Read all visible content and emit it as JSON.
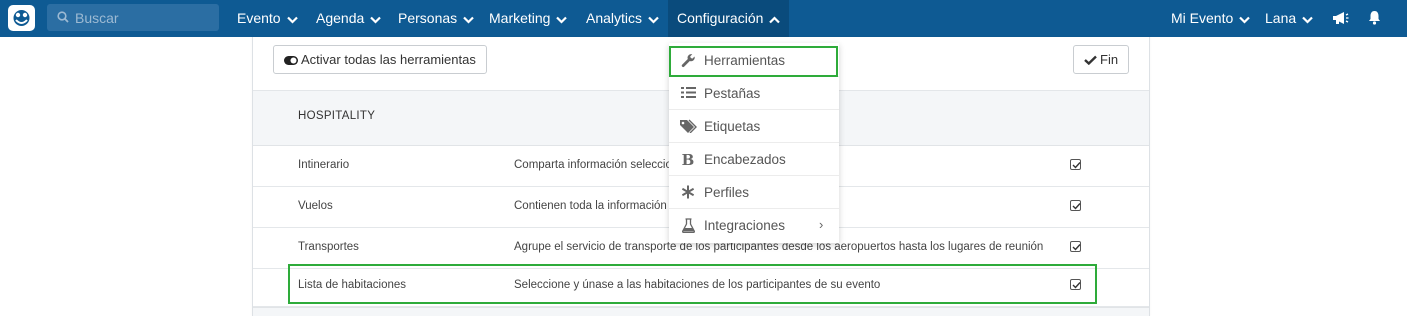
{
  "search": {
    "placeholder": "Buscar"
  },
  "nav": {
    "items": [
      {
        "label": "Evento"
      },
      {
        "label": "Agenda"
      },
      {
        "label": "Personas"
      },
      {
        "label": "Marketing"
      },
      {
        "label": "Analytics"
      },
      {
        "label": "Configuración",
        "active": true
      }
    ],
    "right": [
      {
        "label": "Mi Evento"
      },
      {
        "label": "Lana"
      }
    ],
    "icons": [
      "megaphone-icon",
      "bell-icon"
    ]
  },
  "toolbar": {
    "activate_all_label": "Activar todas las herramientas",
    "done_label": "Fin"
  },
  "section": {
    "title": "HOSPITALITY"
  },
  "tools": [
    {
      "name": "Intinerario",
      "description": "Comparta información seleccio",
      "checked": true
    },
    {
      "name": "Vuelos",
      "description": "Contienen toda la información s                                                                                  s",
      "checked": true
    },
    {
      "name": "Transportes",
      "description": "Agrupe el servicio de transporte de los participantes desde los aeropuertos hasta los lugares de reunión",
      "checked": true
    },
    {
      "name": "Lista de habitaciones",
      "description": "Seleccione y únase a las habitaciones de los participantes de su evento",
      "checked": true
    }
  ],
  "config_menu": {
    "items": [
      {
        "label": "Herramientas",
        "icon": "wrench-icon"
      },
      {
        "label": "Pestañas",
        "icon": "list-icon"
      },
      {
        "label": "Etiquetas",
        "icon": "tags-icon"
      },
      {
        "label": "Encabezados",
        "icon": "bold-icon"
      },
      {
        "label": "Perfiles",
        "icon": "asterisk-icon"
      },
      {
        "label": "Integraciones",
        "icon": "flask-icon",
        "submenu": true
      }
    ]
  },
  "colors": {
    "topbar": "#0e5a93",
    "active_nav": "#0a4b7c",
    "highlight": "#2eab3a"
  }
}
